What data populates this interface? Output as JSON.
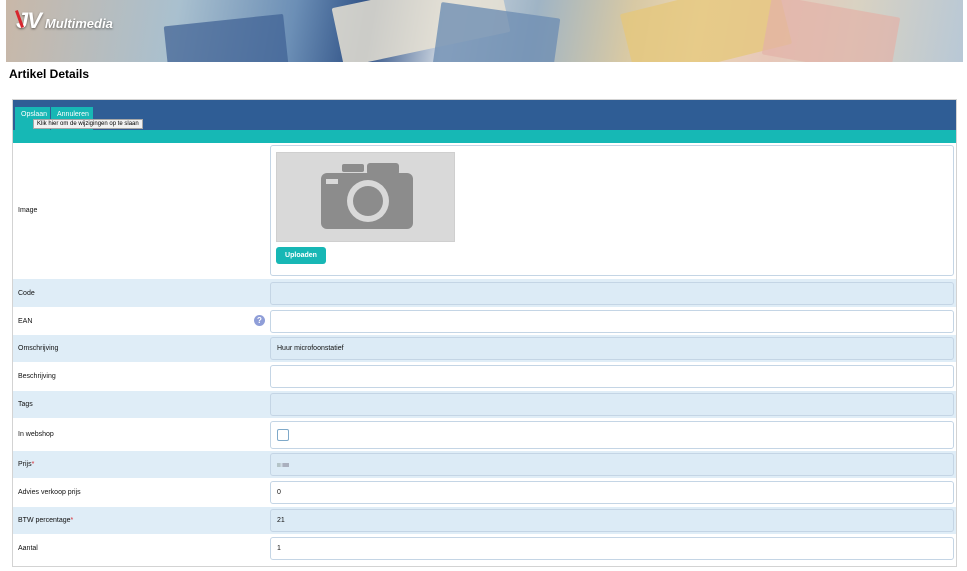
{
  "banner": {
    "logo_mark": "JV",
    "logo_text": "Multimedia"
  },
  "page_title": "Artikel Details",
  "toolbar": {
    "save_label": "Opslaan",
    "cancel_label": "Annuleren",
    "tooltip": "Klik hier om de wijzigingen op te slaan"
  },
  "image_field": {
    "label": "Image",
    "upload_label": "Uploaden",
    "placeholder_icon": "camera-icon"
  },
  "fields": [
    {
      "label": "Code",
      "value": "",
      "required": false,
      "alt": true
    },
    {
      "label": "EAN",
      "value": "",
      "required": false,
      "alt": false,
      "help_icon": "?"
    },
    {
      "label": "Omschrijving",
      "value": "Huur microfoonstatief",
      "required": false,
      "alt": true
    },
    {
      "label": "Beschrijving",
      "value": "",
      "required": false,
      "alt": false
    },
    {
      "label": "Tags",
      "value": "",
      "required": false,
      "alt": true
    },
    {
      "label": "In webshop",
      "type": "checkbox",
      "checked": false,
      "alt": false
    },
    {
      "label": "Prijs",
      "value": "",
      "required": true,
      "alt": true,
      "obscured": true
    },
    {
      "label": "Advies verkoop prijs",
      "value": "0",
      "required": false,
      "alt": false
    },
    {
      "label": "BTW percentage",
      "value": "21",
      "required": true,
      "alt": true
    },
    {
      "label": "Aantal",
      "value": "1",
      "required": false,
      "alt": false
    }
  ],
  "required_marker": "*",
  "colors": {
    "toolbar": "#2f5d95",
    "accent": "#16b8b5",
    "row_alt": "#dfedf7",
    "required": "#d7262e"
  }
}
